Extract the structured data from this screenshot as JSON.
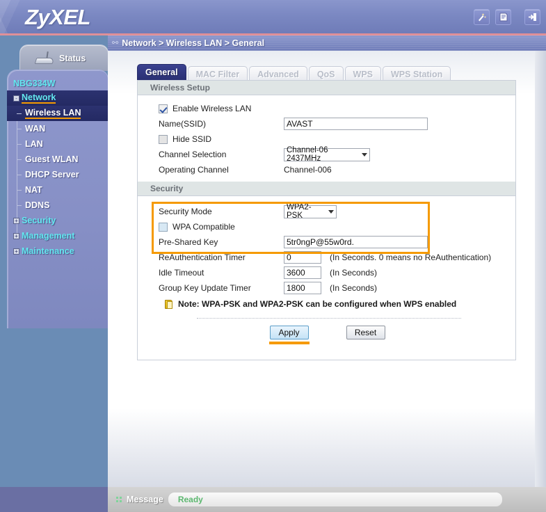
{
  "header": {
    "logo": "ZyXEL",
    "icons": [
      {
        "name": "wizard-icon",
        "glyph": "✦"
      },
      {
        "name": "help-document-icon",
        "glyph": "▤"
      },
      {
        "name": "logout-icon",
        "glyph": "⏎"
      }
    ]
  },
  "breadcrumb": {
    "icon": "site-map-icon",
    "text": "Network > Wireless LAN > General"
  },
  "sidebar": {
    "status_tab": "Status",
    "device_name": "NBG334W",
    "groups": [
      {
        "label": "Network",
        "expander": "-",
        "selected": true
      },
      {
        "label": "Security",
        "expander": "+",
        "selected": false
      },
      {
        "label": "Management",
        "expander": "+",
        "selected": false
      },
      {
        "label": "Maintenance",
        "expander": "+",
        "selected": false
      }
    ],
    "network_children": [
      {
        "label": "Wireless LAN",
        "selected": true
      },
      {
        "label": "WAN",
        "selected": false
      },
      {
        "label": "LAN",
        "selected": false
      },
      {
        "label": "Guest WLAN",
        "selected": false
      },
      {
        "label": "DHCP Server",
        "selected": false
      },
      {
        "label": "NAT",
        "selected": false
      },
      {
        "label": "DDNS",
        "selected": false
      }
    ]
  },
  "tabs": [
    {
      "label": "General",
      "active": true
    },
    {
      "label": "MAC Filter",
      "active": false
    },
    {
      "label": "Advanced",
      "active": false
    },
    {
      "label": "QoS",
      "active": false
    },
    {
      "label": "WPS",
      "active": false
    },
    {
      "label": "WPS Station",
      "active": false
    }
  ],
  "wireless_setup": {
    "section_title": "Wireless Setup",
    "enable_wireless_lan": {
      "label": "Enable Wireless LAN",
      "checked": true
    },
    "ssid": {
      "label": "Name(SSID)",
      "value": "AVAST"
    },
    "hide_ssid": {
      "label": "Hide SSID",
      "checked": false
    },
    "channel_selection": {
      "label": "Channel Selection",
      "value": "Channel-06 2437MHz"
    },
    "operating_channel": {
      "label": "Operating Channel",
      "value": "Channel-006"
    }
  },
  "security": {
    "section_title": "Security",
    "security_mode": {
      "label": "Security Mode",
      "value": "WPA2-PSK"
    },
    "wpa_compatible": {
      "label": "WPA Compatible",
      "checked": false
    },
    "pre_shared_key": {
      "label": "Pre-Shared Key",
      "value": "5tr0ngP@55w0rd."
    },
    "reauth_timer": {
      "label": "ReAuthentication Timer",
      "value": "0",
      "hint": "(In Seconds. 0 means no ReAuthentication)"
    },
    "idle_timeout": {
      "label": "Idle Timeout",
      "value": "3600",
      "hint": "(In Seconds)"
    },
    "group_key_update_timer": {
      "label": "Group Key Update Timer",
      "value": "1800",
      "hint": "(In Seconds)"
    },
    "note": "Note: WPA-PSK and WPA2-PSK can be configured when WPS enabled",
    "highlight_color": "#f59a00"
  },
  "buttons": {
    "apply": "Apply",
    "reset": "Reset"
  },
  "footer": {
    "label": "Message",
    "status": "Ready",
    "status_color": "#5cb870"
  }
}
